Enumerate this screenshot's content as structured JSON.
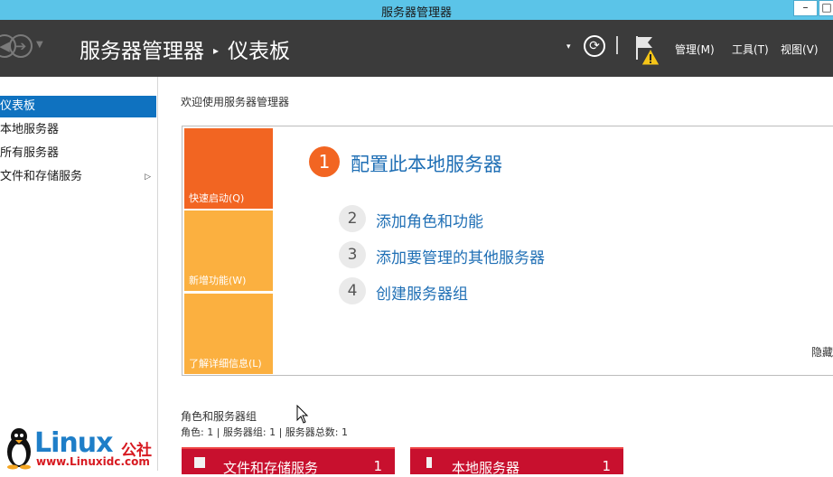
{
  "window": {
    "title": "服务器管理器",
    "min_label": "–",
    "max_label": "□"
  },
  "header": {
    "breadcrumb_app": "服务器管理器",
    "breadcrumb_sep": "▸",
    "breadcrumb_page": "仪表板",
    "back_icon": "◀",
    "forward_icon": "➔",
    "nav_drop": "▼",
    "menu_drop": "▾",
    "refresh_icon": "⟳",
    "menu": [
      "管理(M)",
      "工具(T)",
      "视图(V)"
    ]
  },
  "sidebar": {
    "items": [
      {
        "label": "仪表板",
        "active": true
      },
      {
        "label": "本地服务器",
        "active": false
      },
      {
        "label": "所有服务器",
        "active": false
      },
      {
        "label": "文件和存储服务",
        "active": false,
        "arrow": "▷"
      }
    ]
  },
  "main": {
    "welcome": "欢迎使用服务器管理器",
    "tiles": [
      "快速启动(Q)",
      "新增功能(W)",
      "了解详细信息(L)"
    ],
    "steps": [
      {
        "num": "1",
        "label": "配置此本地服务器"
      },
      {
        "num": "2",
        "label": "添加角色和功能"
      },
      {
        "num": "3",
        "label": "添加要管理的其他服务器"
      },
      {
        "num": "4",
        "label": "创建服务器组"
      }
    ],
    "hide": "隐藏",
    "roles_title": "角色和服务器组",
    "roles_summary": "角色: 1 | 服务器组: 1 | 服务器总数: 1",
    "cards": [
      {
        "name": "文件和存储服务",
        "count": "1"
      },
      {
        "name": "本地服务器",
        "count": "1"
      }
    ]
  },
  "watermark": {
    "logo": "Linux",
    "cn": "公社",
    "url": "www.Linuxidc.com"
  },
  "colors": {
    "titlebar": "#5bc4e8",
    "header": "#3b3b3b",
    "accent": "#0f72c0",
    "quickstart": "#f26522",
    "tile": "#fbb040",
    "card": "#c8102e"
  }
}
